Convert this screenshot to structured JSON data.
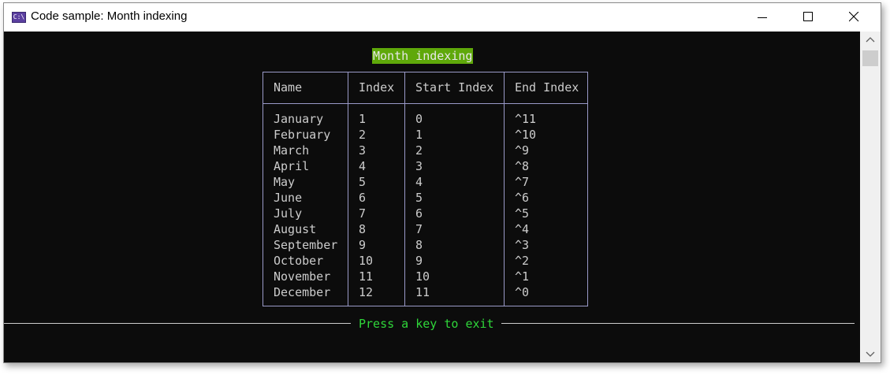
{
  "window": {
    "title": "Code sample: Month indexing",
    "icon": "console-app-icon",
    "icon_text": "C:\\"
  },
  "console": {
    "heading": "Month indexing",
    "table": {
      "columns": [
        "Name",
        "Index",
        "Start Index",
        "End Index"
      ],
      "rows": [
        [
          "January",
          "1",
          "0",
          "^11"
        ],
        [
          "February",
          "2",
          "1",
          "^10"
        ],
        [
          "March",
          "3",
          "2",
          "^9"
        ],
        [
          "April",
          "4",
          "3",
          "^8"
        ],
        [
          "May",
          "5",
          "4",
          "^7"
        ],
        [
          "June",
          "6",
          "5",
          "^6"
        ],
        [
          "July",
          "7",
          "6",
          "^5"
        ],
        [
          "August",
          "8",
          "7",
          "^4"
        ],
        [
          "September",
          "9",
          "8",
          "^3"
        ],
        [
          "October",
          "10",
          "9",
          "^2"
        ],
        [
          "November",
          "11",
          "10",
          "^1"
        ],
        [
          "December",
          "12",
          "11",
          "^0"
        ]
      ]
    },
    "footer": "Press a key to exit"
  },
  "colors": {
    "background": "#0c0c0c",
    "text": "#cccccc",
    "heading_bg": "#5fa80a",
    "footer_text": "#2fd63a",
    "table_border": "#9a9ac8"
  }
}
